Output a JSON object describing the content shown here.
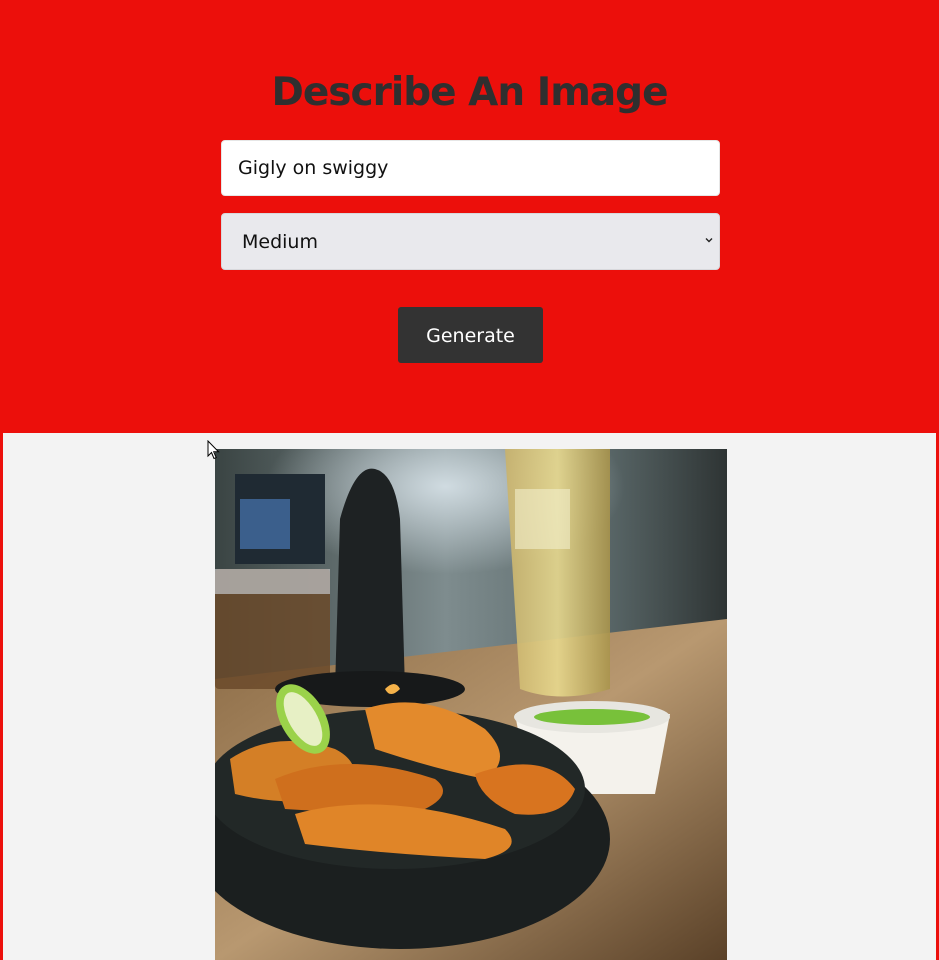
{
  "header": {
    "title": "Describe An Image"
  },
  "form": {
    "prompt_value": "Gigly on swiggy",
    "size_selected": "Medium",
    "generate_label": "Generate"
  },
  "result": {
    "image_description": "generated image of a restaurant table with a black bowl of orange food, a small cup of green sauce and a tall glass"
  },
  "colors": {
    "accent": "#ec0f0b",
    "title_text": "#2f2f2f",
    "button_bg": "#333333",
    "result_bg": "#f3f3f3"
  }
}
